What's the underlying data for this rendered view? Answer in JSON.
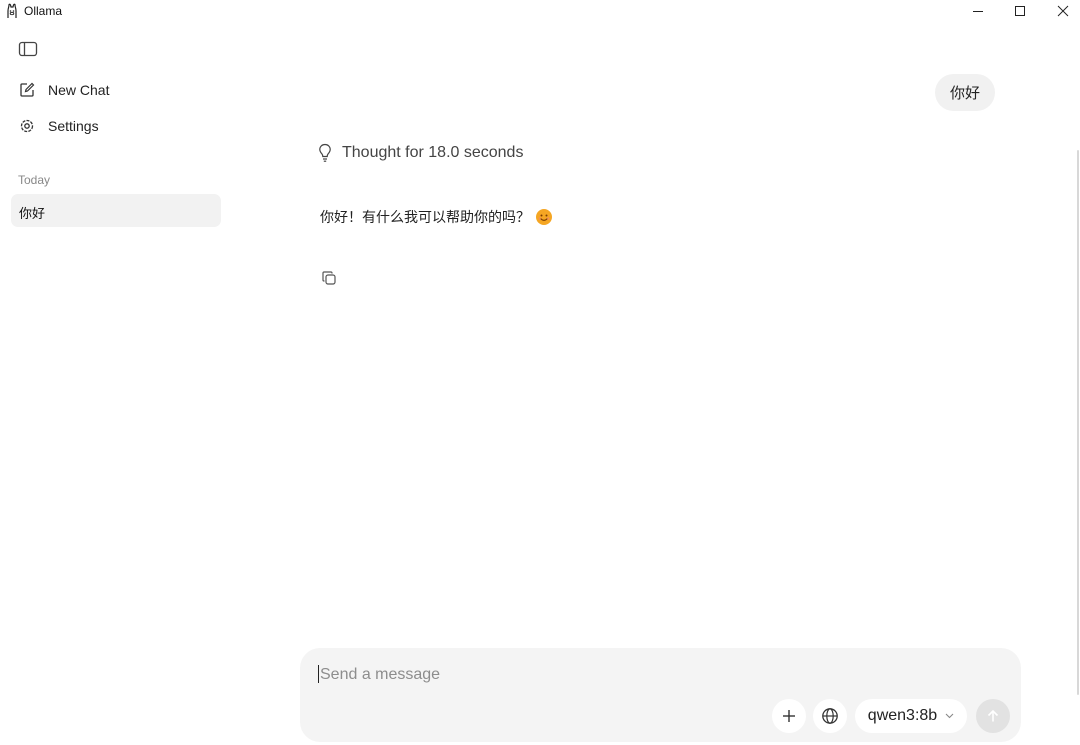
{
  "window": {
    "title": "Ollama"
  },
  "sidebar": {
    "nav": [
      {
        "label": "New Chat",
        "icon": "new-chat-icon"
      },
      {
        "label": "Settings",
        "icon": "gear-icon"
      }
    ],
    "section_label": "Today",
    "history": [
      {
        "label": "你好"
      }
    ]
  },
  "conversation": {
    "user_message": "你好",
    "thought_label": "Thought for 18.0 seconds",
    "assistant_message": "你好！有什么我可以帮助你的吗？",
    "assistant_emoji": "smiling-face"
  },
  "composer": {
    "placeholder": "Send a message",
    "value": "",
    "model": "qwen3:8b"
  },
  "colors": {
    "accent_emoji": "#f5a623",
    "bubble": "#f1f1f1",
    "composer": "#f4f4f4"
  }
}
